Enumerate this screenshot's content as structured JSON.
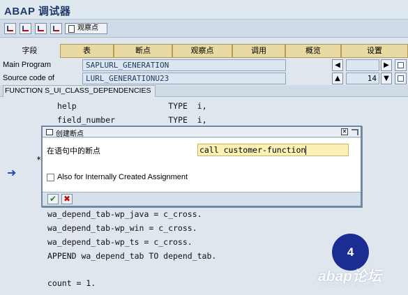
{
  "window": {
    "title": "ABAP 调试器"
  },
  "toolbar": {
    "watch_label": "观察点"
  },
  "tabs": {
    "field_label": "字段",
    "items": [
      {
        "label": "表"
      },
      {
        "label": "断点"
      },
      {
        "label": "观察点"
      },
      {
        "label": "调用"
      },
      {
        "label": "概览"
      },
      {
        "label": "设置"
      }
    ]
  },
  "main_program": {
    "label": "Main Program",
    "value": "SAPLURL_GENERATION"
  },
  "source_code": {
    "label": "Source code of",
    "value": "LURL_GENERATIONU23",
    "line": "14"
  },
  "section": {
    "title": "FUNCTION S_UI_CLASS_DEPENDENCIES"
  },
  "code_lines": [
    "help                   TYPE  i,",
    "field_number           TYPE  i,",
    "wa_depend_tab-wp_java = c_cross.",
    "wa_depend_tab-wp_win = c_cross.",
    "wa_depend_tab-wp_ts = c_cross.",
    "APPEND wa_depend_tab TO depend_tab.",
    "count = 1."
  ],
  "code_star": "*",
  "dialog": {
    "title": "创建断点",
    "statement_label": "在语句中的断点",
    "statement_value": "call customer-function",
    "checkbox_label": "Also for Internally Created Assignment",
    "checkbox_checked": false
  },
  "step_badge": "4",
  "watermark": {
    "main": "abap论坛",
    "url": "www.sapabap.cn"
  }
}
